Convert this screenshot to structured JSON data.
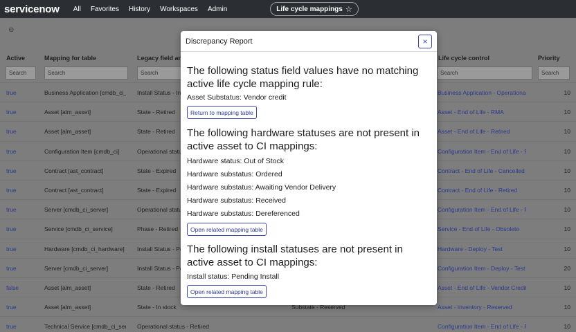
{
  "nav": {
    "logo": "servicenow",
    "items": [
      "All",
      "Favorites",
      "History",
      "Workspaces",
      "Admin"
    ],
    "pill_label": "Life cycle mappings"
  },
  "table": {
    "columns": [
      "Active",
      "Mapping for table",
      "Legacy field and",
      "Life cycle control",
      "Priority"
    ],
    "search_placeholder": "Search",
    "rows": [
      {
        "active": "true",
        "mapping": "Business Application [cmdb_ci_l",
        "legacy": "Install Status - In",
        "extra": "",
        "lifecycle": "Business Application - Operationa",
        "priority": "10"
      },
      {
        "active": "true",
        "mapping": "Asset [alm_asset]",
        "legacy": "State - Retired",
        "extra": "",
        "lifecycle": "Asset - End of Life - RMA",
        "priority": "10"
      },
      {
        "active": "true",
        "mapping": "Asset [alm_asset]",
        "legacy": "State - Retired",
        "extra": "",
        "lifecycle": "Asset - End of Life - Retired",
        "priority": "10"
      },
      {
        "active": "true",
        "mapping": "Configuration Item [cmdb_ci]",
        "legacy": "Operational statu",
        "extra": "",
        "lifecycle": "Configuration Item - End of Life - F",
        "priority": "10"
      },
      {
        "active": "true",
        "mapping": "Contract [ast_contract]",
        "legacy": "State - Expired",
        "extra": "",
        "lifecycle": "Contract - End of Life - Cancelled",
        "priority": "10"
      },
      {
        "active": "true",
        "mapping": "Contract [ast_contract]",
        "legacy": "State - Expired",
        "extra": "",
        "lifecycle": "Contract - End of Life - Retired",
        "priority": "10"
      },
      {
        "active": "true",
        "mapping": "Server [cmdb_ci_server]",
        "legacy": "Operational statu",
        "extra": "",
        "lifecycle": "Configuration Item - End of Life - F",
        "priority": "10"
      },
      {
        "active": "true",
        "mapping": "Service [cmdb_ci_service]",
        "legacy": "Phase - Retired",
        "extra": "",
        "lifecycle": "Service - End of Life - Obsolete",
        "priority": "10"
      },
      {
        "active": "true",
        "mapping": "Hardware [cmdb_ci_hardware]",
        "legacy": "Install Status - Pe",
        "extra": "",
        "lifecycle": "Hardware - Deploy - Test",
        "priority": "10"
      },
      {
        "active": "true",
        "mapping": "Server [cmdb_ci_server]",
        "legacy": "Install Status - Pe",
        "extra": "",
        "lifecycle": "Configuration Item - Deploy - Test",
        "priority": "20"
      },
      {
        "active": "false",
        "mapping": "Asset [alm_asset]",
        "legacy": "State - Retired",
        "extra": "",
        "lifecycle": "Asset - End of Life - Vendor Credit",
        "priority": "10"
      },
      {
        "active": "true",
        "mapping": "Asset [alm_asset]",
        "legacy": "State - In stock",
        "extra": "Substate - Reserved",
        "lifecycle": "Asset - Inventory - Reserved",
        "priority": "10"
      },
      {
        "active": "true",
        "mapping": "Technical Service [cmdb_ci_serv",
        "legacy": "Operational status - Retired",
        "extra": "",
        "lifecycle": "Configuration Item - End of Life - F",
        "priority": "10"
      }
    ]
  },
  "modal": {
    "title": "Discrepancy Report",
    "close_label": "×",
    "section1": {
      "heading": "The following status field values have no matching active life cycle mapping rule:",
      "items": [
        "Asset Substatus: Vendor credit"
      ],
      "button": "Return to mapping table"
    },
    "section2": {
      "heading": "The following hardware statuses are not present in active asset to CI mappings:",
      "items": [
        "Hardware status: Out of Stock",
        "Hardware substatus: Ordered",
        "Hardware substatus: Awaiting Vendor Delivery",
        "Hardware substatus: Received",
        "Hardware substatus: Dereferenced"
      ],
      "button": "Open related mapping table"
    },
    "section3": {
      "heading": "The following install statuses are not present in active asset to CI mappings:",
      "items": [
        "Install status: Pending Install"
      ],
      "button": "Open related mapping table"
    }
  },
  "colors": {
    "nav_bg": "#2b2f33",
    "link": "#2b3a8f",
    "button_border": "#3c4aa5"
  }
}
